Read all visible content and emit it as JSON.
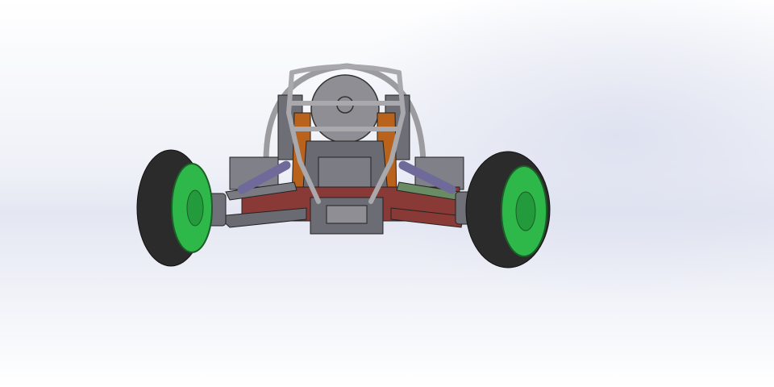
{
  "scene": {
    "subject": "rc-car-chassis-front-view",
    "colors": {
      "tire": "#2b2b2b",
      "wheel": "#2fb84a",
      "chassis": "#7a7a82",
      "frame": "#a9a9ad",
      "orange_plate": "#b8621c",
      "red_plate": "#8a3a36",
      "shock": "#6e6a9a",
      "arm_green": "#6a8c64",
      "background": "#eceef6"
    }
  }
}
